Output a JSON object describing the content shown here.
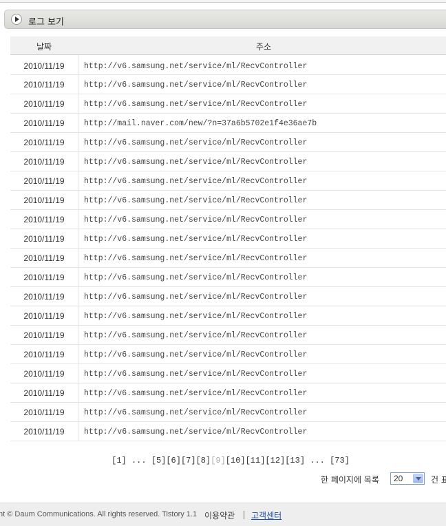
{
  "section": {
    "title": "로그 보기",
    "toggle_icon": "play-circle-icon"
  },
  "table": {
    "columns": [
      "날짜",
      "주소"
    ],
    "rows": [
      {
        "date": "2010/11/19",
        "url": "http://v6.samsung.net/service/ml/RecvController"
      },
      {
        "date": "2010/11/19",
        "url": "http://v6.samsung.net/service/ml/RecvController"
      },
      {
        "date": "2010/11/19",
        "url": "http://v6.samsung.net/service/ml/RecvController"
      },
      {
        "date": "2010/11/19",
        "url": "http://mail.naver.com/new/?n=37a6b5702e1f4e36ae7b"
      },
      {
        "date": "2010/11/19",
        "url": "http://v6.samsung.net/service/ml/RecvController"
      },
      {
        "date": "2010/11/19",
        "url": "http://v6.samsung.net/service/ml/RecvController"
      },
      {
        "date": "2010/11/19",
        "url": "http://v6.samsung.net/service/ml/RecvController"
      },
      {
        "date": "2010/11/19",
        "url": "http://v6.samsung.net/service/ml/RecvController"
      },
      {
        "date": "2010/11/19",
        "url": "http://v6.samsung.net/service/ml/RecvController"
      },
      {
        "date": "2010/11/19",
        "url": "http://v6.samsung.net/service/ml/RecvController"
      },
      {
        "date": "2010/11/19",
        "url": "http://v6.samsung.net/service/ml/RecvController"
      },
      {
        "date": "2010/11/19",
        "url": "http://v6.samsung.net/service/ml/RecvController"
      },
      {
        "date": "2010/11/19",
        "url": "http://v6.samsung.net/service/ml/RecvController"
      },
      {
        "date": "2010/11/19",
        "url": "http://v6.samsung.net/service/ml/RecvController"
      },
      {
        "date": "2010/11/19",
        "url": "http://v6.samsung.net/service/ml/RecvController"
      },
      {
        "date": "2010/11/19",
        "url": "http://v6.samsung.net/service/ml/RecvController"
      },
      {
        "date": "2010/11/19",
        "url": "http://v6.samsung.net/service/ml/RecvController"
      },
      {
        "date": "2010/11/19",
        "url": "http://v6.samsung.net/service/ml/RecvController"
      },
      {
        "date": "2010/11/19",
        "url": "http://v6.samsung.net/service/ml/RecvController"
      },
      {
        "date": "2010/11/19",
        "url": "http://v6.samsung.net/service/ml/RecvController"
      }
    ]
  },
  "pagination": {
    "items": [
      {
        "label": "[1]",
        "current": false
      },
      {
        "label": "...",
        "current": false
      },
      {
        "label": "[5]",
        "current": false
      },
      {
        "label": "[6]",
        "current": false
      },
      {
        "label": "[7]",
        "current": false
      },
      {
        "label": "[8]",
        "current": false
      },
      {
        "label": "[9]",
        "current": true
      },
      {
        "label": "[10]",
        "current": false
      },
      {
        "label": "[11]",
        "current": false
      },
      {
        "label": "[12]",
        "current": false
      },
      {
        "label": "[13]",
        "current": false
      },
      {
        "label": "...",
        "current": false
      },
      {
        "label": "[73]",
        "current": false
      }
    ]
  },
  "per_page": {
    "label": "한 페이지에 목록",
    "value": "20",
    "unit": "건 표"
  },
  "footer": {
    "copyright": "nt © Daum Communications. All rights reserved.   Tistory 1.1",
    "terms": "이용약관",
    "help": "고객센터"
  }
}
